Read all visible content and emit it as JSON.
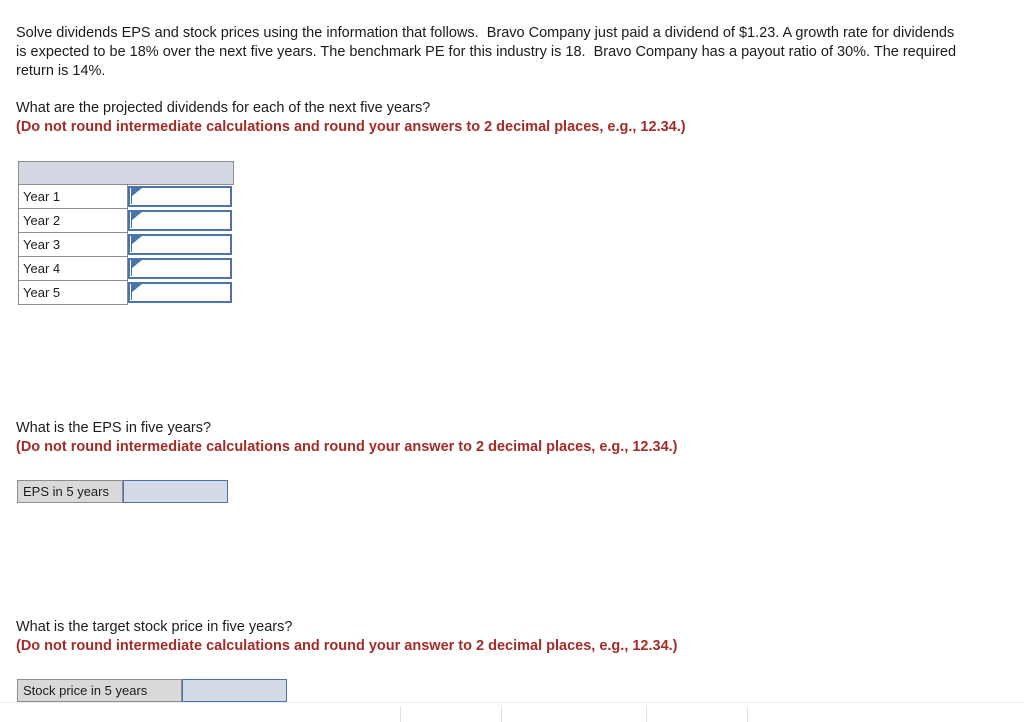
{
  "document": {
    "prompt": "Solve dividends EPS and stock prices using the information that follows.  Bravo Company just paid a dividend of $1.23. A growth rate for dividends is expected to be 18% over the next five years. The benchmark PE for this industry is 18.  Bravo Company has a payout ratio of 30%. The required return is 14%."
  },
  "colors": {
    "note_red": "#a32c29",
    "field_border_blue": "#4a73a8",
    "field_shaded_fill": "#d4dae6",
    "table_header_fill": "#d3d8e3",
    "label_gray_fill": "#d9d9d9"
  },
  "questions": [
    {
      "id": "dividends",
      "text": "What are the projected dividends for each of the next five years?",
      "note": "(Do not round intermediate calculations and round your answers to 2 decimal places, e.g., 12.34.)",
      "table": {
        "header_label": "",
        "rows": [
          {
            "label": "Year 1",
            "value": ""
          },
          {
            "label": "Year 2",
            "value": ""
          },
          {
            "label": "Year 3",
            "value": ""
          },
          {
            "label": "Year 4",
            "value": ""
          },
          {
            "label": "Year 5",
            "value": ""
          }
        ]
      }
    },
    {
      "id": "eps",
      "text": "What is the EPS in five years?",
      "note": "(Do not round intermediate calculations and round your answer to 2 decimal places, e.g., 12.34.)",
      "row": {
        "label": "EPS in 5 years",
        "value": ""
      }
    },
    {
      "id": "stock-price",
      "text": "What is the target stock price in five years?",
      "note": "(Do not round intermediate calculations and round your answer to 2 decimal places, e.g., 12.34.)",
      "row": {
        "label": "Stock price in 5 years",
        "value": ""
      }
    }
  ]
}
